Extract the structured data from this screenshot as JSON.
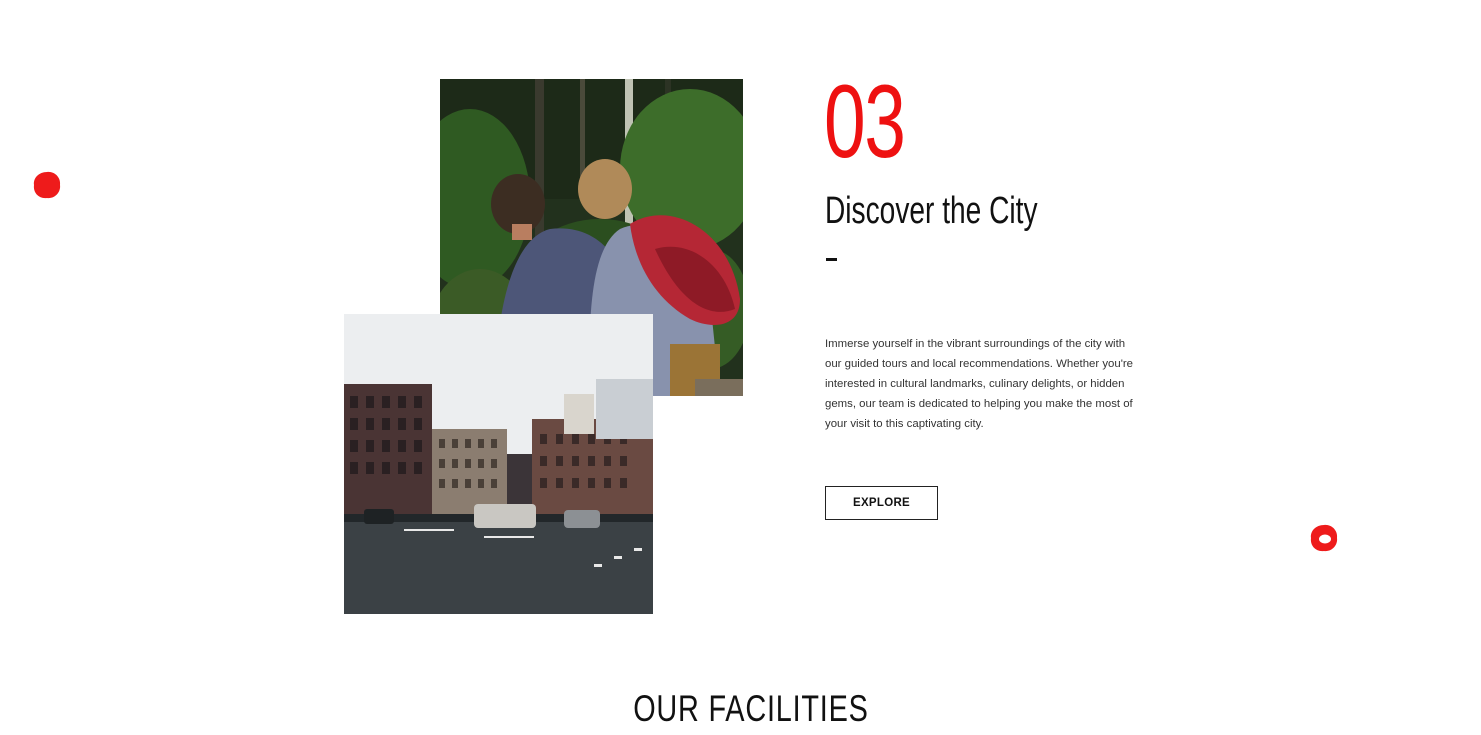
{
  "colors": {
    "accent": "#ee1111",
    "text": "#111111",
    "body_text": "#333333",
    "background": "#ffffff"
  },
  "decorations": [
    "red-paint-dot-icon",
    "red-paint-ring-icon"
  ],
  "gallery": {
    "forest_photo": "two-boys-in-forest-photo",
    "street_photo": "city-street-intersection-photo"
  },
  "feature": {
    "number": "03",
    "title": "Discover the City",
    "description": "Immerse yourself in the vibrant surroundings of the city with our guided tours and local recommendations. Whether you're interested in cultural landmarks, culinary delights, or hidden gems, our team is dedicated to helping you make the most of your visit to this captivating city.",
    "button_label": "EXPLORE"
  },
  "facilities": {
    "heading": "OUR FACILITIES"
  }
}
